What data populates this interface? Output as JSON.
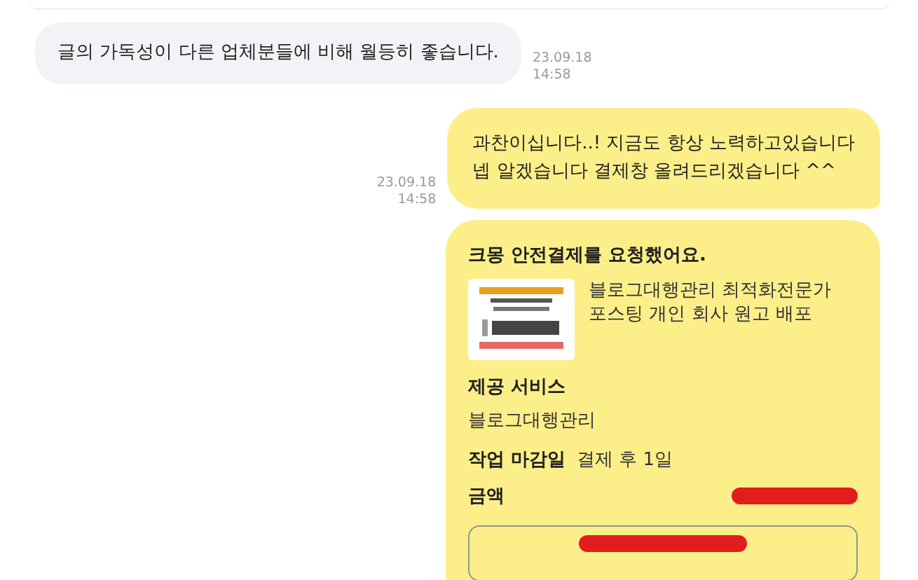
{
  "messages": [
    {
      "kind": "received",
      "lines": [
        "글의 가독성이 다른 업체분들에 비해 월등히 좋습니다."
      ],
      "date": "23.09.18",
      "time": "14:58"
    },
    {
      "kind": "sent",
      "lines": [
        "과찬이십니다..! 지금도 항상 노력하고있습니다",
        "넵 알겠습니다 결제창 올려드리겠습니다 ^^"
      ],
      "date": "23.09.18",
      "time": "14:58"
    }
  ],
  "payment_card": {
    "title": "크몽 안전결제를 요청했어요.",
    "product_lines": [
      "블로그대행관리 최적화전문가",
      "포스팅 개인 회사 원고 배포"
    ],
    "service_label": "제공 서비스",
    "service_value": "블로그대행관리",
    "deadline_label": "작업 마감일",
    "deadline_value": "결제 후 1일",
    "amount_label": "금액",
    "amount_redacted": true,
    "button_redacted": true
  }
}
